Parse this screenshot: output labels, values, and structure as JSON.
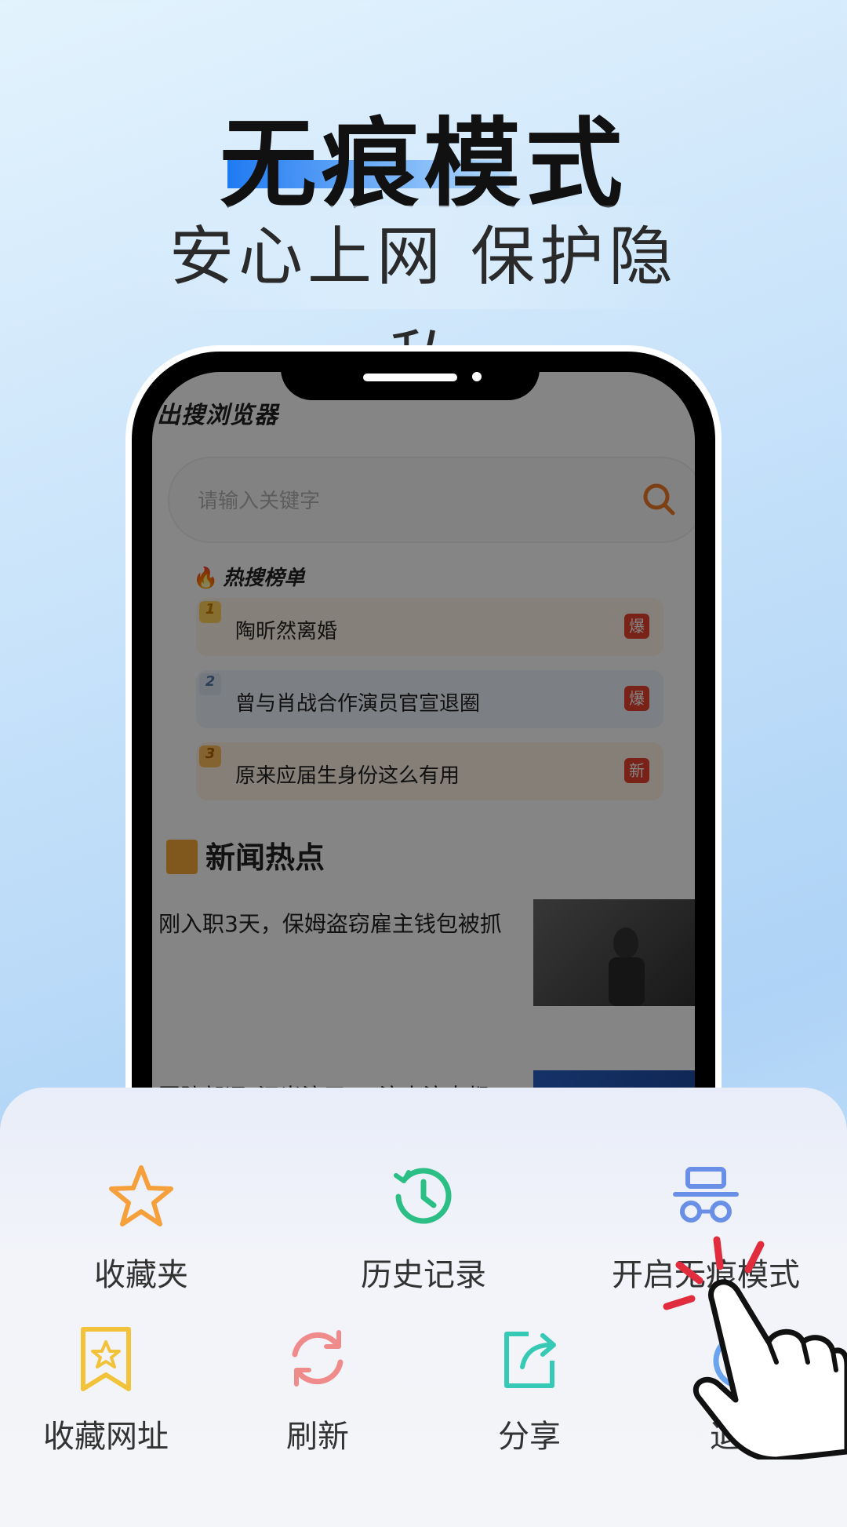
{
  "hero": {
    "title": "无痕模式",
    "subtitle": "安心上网 保护隐私"
  },
  "phone_app": {
    "app_name": "出搜浏览器",
    "search_placeholder": "请输入关键字",
    "hot_section_title": "热搜榜单",
    "hot_items": [
      {
        "rank": "1",
        "label": "陶昕然离婚",
        "badge": "爆"
      },
      {
        "rank": "2",
        "label": "曾与肖战合作演员官宣退圈",
        "badge": "爆"
      },
      {
        "rank": "3",
        "label": "原来应届生身份这么有用",
        "badge": "新"
      }
    ],
    "news_section_title": "新闻热点",
    "news_items": [
      {
        "title": "刚入职3天，保姆盗窃雇主钱包被抓"
      },
      {
        "title": "国防部评“汉光演习”：演来演去都"
      }
    ]
  },
  "menu": {
    "row1": [
      {
        "label": "收藏夹",
        "icon": "star-icon"
      },
      {
        "label": "历史记录",
        "icon": "history-clock-icon"
      },
      {
        "label": "开启无痕模式",
        "icon": "incognito-icon"
      }
    ],
    "row2": [
      {
        "label": "收藏网址",
        "icon": "bookmark-star-icon"
      },
      {
        "label": "刷新",
        "icon": "refresh-icon"
      },
      {
        "label": "分享",
        "icon": "share-icon"
      },
      {
        "label": "退出",
        "icon": "exit-icon"
      }
    ]
  },
  "colors": {
    "accent_blue": "#1f7af2",
    "star_orange": "#f5a03b",
    "history_green": "#2bbf86",
    "incognito_blue": "#6a8fe6",
    "bookmark_yellow": "#f2c33a",
    "refresh_pink": "#f08b8b",
    "share_teal": "#35c9b6",
    "badge_red": "#e8412e"
  }
}
